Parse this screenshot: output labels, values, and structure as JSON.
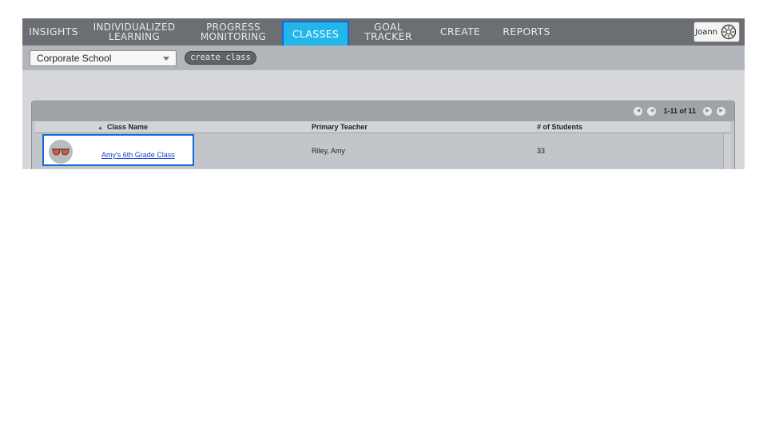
{
  "nav": {
    "items": [
      {
        "label": "INSIGHTS"
      },
      {
        "label": "INDIVIDUALIZED\nLEARNING"
      },
      {
        "label": "PROGRESS\nMONITORING"
      },
      {
        "label": "CLASSES"
      },
      {
        "label": "GOAL TRACKER"
      },
      {
        "label": "CREATE"
      },
      {
        "label": "REPORTS"
      }
    ],
    "active": "CLASSES",
    "user_name": "Joann"
  },
  "toolbar": {
    "school_selected": "Corporate School",
    "create_class_label": "create class"
  },
  "table": {
    "page_info": "1-11 of 11",
    "columns": {
      "class_name": "Class Name",
      "teacher": "Primary Teacher",
      "students": "# of Students"
    },
    "rows": [
      {
        "class_name": "Amy's 6th Grade Class",
        "teacher": "Riley, Amy",
        "students": "33"
      }
    ]
  },
  "colors": {
    "nav_bg": "#6b6e72",
    "active_tab": "#22b6ea",
    "highlight_border": "#1469d8",
    "link": "#1a3ad0"
  }
}
